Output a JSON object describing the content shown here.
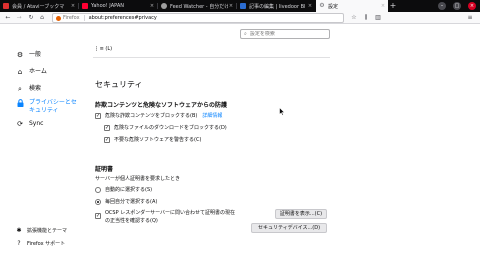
{
  "tabs": [
    {
      "title": "会員 / Ataviーブックマ",
      "favicon_color": "#e03131"
    },
    {
      "title": "Yahoo! JAPAN",
      "favicon_color": "#ff0033"
    },
    {
      "title": "Feed Watcher - 自分だけ",
      "favicon_color": "#9e9e9e"
    },
    {
      "title": "記事の編集 | livedoor Bl",
      "favicon_color": "#2b6cd1"
    },
    {
      "title": "設定",
      "favicon_color": "#6c6c70",
      "active": true
    }
  ],
  "window_controls": {
    "minimize": "–",
    "maximize": "□",
    "close": "×"
  },
  "new_tab": "+",
  "urlbar": {
    "brand": "Firefox",
    "url": "about:preferences#privacy"
  },
  "sidebar": {
    "items": [
      {
        "label": "一般",
        "icon": "gear-icon"
      },
      {
        "label": "ホーム",
        "icon": "home-icon"
      },
      {
        "label": "検索",
        "icon": "search-icon"
      },
      {
        "label": "プライバシーとセキュリティ",
        "label_line1": "プライバシーとセ",
        "label_line2": "キュリティ",
        "icon": "lock-icon",
        "selected": true
      },
      {
        "label": "Sync",
        "icon": "sync-icon"
      }
    ],
    "footer": [
      {
        "label": "拡張機能とテーマ",
        "icon": "puzzle-icon"
      },
      {
        "label": "Firefox サポート",
        "icon": "help-icon"
      }
    ]
  },
  "main": {
    "search_placeholder": "設定を検索",
    "section_title": "セキュリティ",
    "phishing": {
      "heading": "詐欺コンテンツと危険なソフトウェアからの防護",
      "block_dangerous": "危険な詐欺コンテンツをブロックする(B)",
      "learn_more": "詳細情報",
      "block_downloads": "危険なファイルのダウンロードをブロックする(D)",
      "warn_software": "不要な危険ソフトウェアを警告する(C)"
    },
    "certificates": {
      "heading": "証明書",
      "prompt": "サーバーが個人証明書を要求したとき",
      "auto_select": "自動的に選択する(S)",
      "ask_every_time": "毎回自分で選択する(A)",
      "ocsp_line1": "OCSP レスポンダーサーバーに問い合わせて証明書の現在",
      "ocsp_line2": "の正当性を確認する(Q)",
      "view_certs_button": "証明書を表示...(C)",
      "security_devices_button": "セキュリティデバイス...(D)"
    }
  },
  "colors": {
    "accent": "#0a84ff",
    "tabstrip": "#0c0c0d",
    "danger": "#d70022"
  }
}
